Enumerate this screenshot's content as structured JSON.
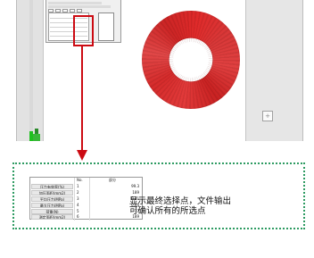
{
  "table": {
    "headers": {
      "no": "No.",
      "part": "部分"
    },
    "rows": [
      {
        "label": "压力有效率(%)",
        "no": "1",
        "value": "99.3"
      },
      {
        "label": "加压面积(mm2)",
        "no": "2",
        "value": "189"
      },
      {
        "label": "平均压力(MPa)",
        "no": "3",
        "value": "0.41"
      },
      {
        "label": "最大压力(MPa)",
        "no": "4",
        "value": "0.64"
      },
      {
        "label": "荷重(N)",
        "no": "5",
        "value": "77"
      },
      {
        "label": "测定面积(mm2)",
        "no": "6",
        "value": "189"
      }
    ]
  },
  "note": {
    "line1": "显示最终选择点，文件输出",
    "line2": "可确认所有的所选点"
  },
  "colors": {
    "highlight": "#cc0a12",
    "callout_border": "#2e9b62",
    "ring_fill": "#d83030"
  }
}
